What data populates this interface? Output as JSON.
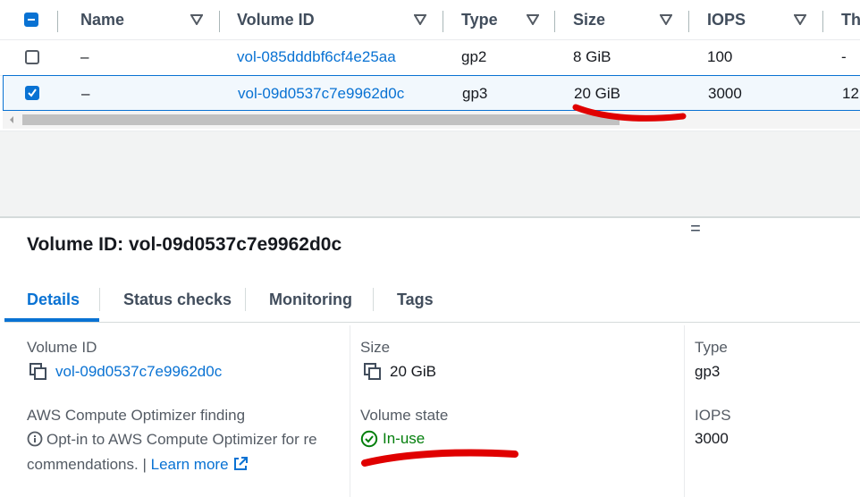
{
  "table": {
    "columns": [
      {
        "label": "Name"
      },
      {
        "label": "Volume ID"
      },
      {
        "label": "Type"
      },
      {
        "label": "Size"
      },
      {
        "label": "IOPS"
      },
      {
        "label": "Th"
      }
    ],
    "rows": [
      {
        "selected": false,
        "name": "–",
        "volume_id": "vol-085dddbf6cf4e25aa",
        "type": "gp2",
        "size": "8 GiB",
        "iops": "100",
        "throughput": "-"
      },
      {
        "selected": true,
        "name": "–",
        "volume_id": "vol-09d0537c7e9962d0c",
        "type": "gp3",
        "size": "20 GiB",
        "iops": "3000",
        "throughput": "12"
      }
    ]
  },
  "details_panel": {
    "title": "Volume ID: vol-09d0537c7e9962d0c",
    "tabs": [
      {
        "label": "Details",
        "active": true
      },
      {
        "label": "Status checks",
        "active": false
      },
      {
        "label": "Monitoring",
        "active": false
      },
      {
        "label": "Tags",
        "active": false
      }
    ],
    "fields": {
      "volume_id_label": "Volume ID",
      "volume_id_value": "vol-09d0537c7e9962d0c",
      "size_label": "Size",
      "size_value": "20 GiB",
      "type_label": "Type",
      "type_value": "gp3",
      "optimizer_label": "AWS Compute Optimizer finding",
      "optimizer_text_line1": "Opt-in to AWS Compute Optimizer for re",
      "optimizer_text_line2": "commendations. |",
      "learn_more": "Learn more",
      "state_label": "Volume state",
      "state_value": "In-use",
      "iops_label": "IOPS",
      "iops_value": "3000"
    }
  },
  "colors": {
    "link": "#0972d3",
    "selected_row_bg": "#f2f8fd",
    "success_green": "#037f0c",
    "annotation_red": "#e00000"
  }
}
